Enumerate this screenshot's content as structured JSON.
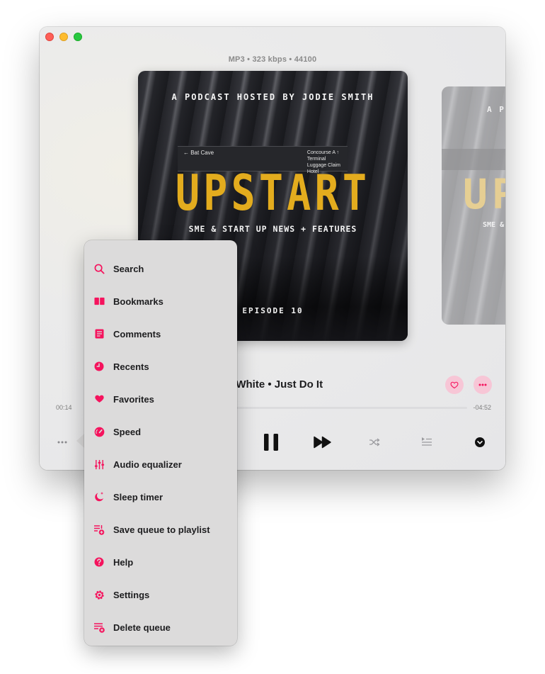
{
  "colors": {
    "accent": "#f5135d",
    "accent_soft": "#f7c6d6",
    "artwork_title": "#e3ac1e"
  },
  "player": {
    "format_info": "MP3 • 323 kbps • 44100",
    "track_title": "n White • Just Do It",
    "elapsed": "00:14",
    "remaining": "-04:52",
    "progress": 0.047
  },
  "artwork": {
    "kicker": "A PODCAST HOSTED BY JODIE SMITH",
    "title": "UPSTART",
    "subtitle": "SME & START UP NEWS + FEATURES",
    "episode": "EPISODE 10",
    "sign_left": "← Bat Cave",
    "sign_right": "Concourse A ↑\nTerminal\nLuggage Claim\nHotel"
  },
  "artwork_next": {
    "kicker": "A PO",
    "title": "UP",
    "subtitle": "SME &"
  },
  "icons": {
    "favorite": "heart-outline-icon",
    "more": "ellipsis-icon",
    "menu": "ellipsis-icon",
    "pause": "pause-icon",
    "forward": "fast-forward-icon",
    "shuffle": "shuffle-icon",
    "queue": "queue-list-icon",
    "collapse": "chevron-down-circle-icon"
  },
  "menu": {
    "items": [
      {
        "label": "Search",
        "icon": "search-icon"
      },
      {
        "label": "Bookmarks",
        "icon": "bookmarks-icon"
      },
      {
        "label": "Comments",
        "icon": "comments-icon"
      },
      {
        "label": "Recents",
        "icon": "clock-icon"
      },
      {
        "label": "Favorites",
        "icon": "heart-icon"
      },
      {
        "label": "Speed",
        "icon": "speedometer-icon"
      },
      {
        "label": "Audio equalizer",
        "icon": "equalizer-icon"
      },
      {
        "label": "Sleep timer",
        "icon": "moon-icon"
      },
      {
        "label": "Save queue to playlist",
        "icon": "add-to-playlist-icon"
      },
      {
        "label": "Help",
        "icon": "question-icon"
      },
      {
        "label": "Settings",
        "icon": "gear-icon"
      },
      {
        "label": "Delete queue",
        "icon": "delete-queue-icon"
      }
    ]
  }
}
